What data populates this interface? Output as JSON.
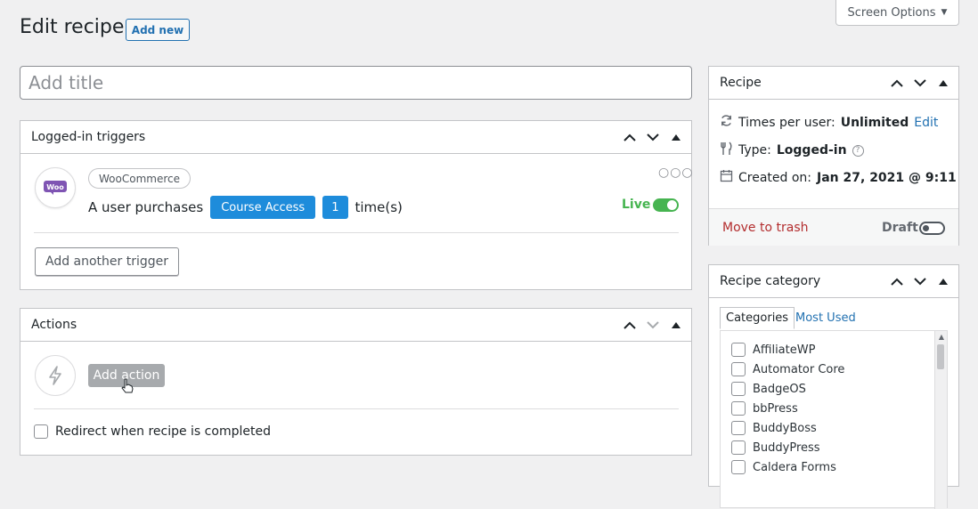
{
  "header": {
    "title": "Edit recipe",
    "add_new": "Add new",
    "screen_options": "Screen Options"
  },
  "title_input": {
    "placeholder": "Add title"
  },
  "triggers": {
    "heading": "Logged-in triggers",
    "integration": "WooCommerce",
    "sentence_prefix": "A user purchases",
    "token_product": "Course Access",
    "token_count": "1",
    "sentence_suffix": "time(s)",
    "status": "Live",
    "add_button": "Add another trigger"
  },
  "actions": {
    "heading": "Actions",
    "add_button": "Add action",
    "redirect_label": "Redirect when recipe is completed"
  },
  "recipe": {
    "heading": "Recipe",
    "times_label": "Times per user:",
    "times_value": "Unlimited",
    "edit_link": "Edit",
    "type_label": "Type:",
    "type_value": "Logged-in",
    "created_label": "Created on:",
    "created_value": "Jan 27, 2021 @ 9:11",
    "trash": "Move to trash",
    "draft": "Draft"
  },
  "category": {
    "heading": "Recipe category",
    "tab_all": "Categories",
    "tab_used": "Most Used",
    "items": [
      "AffiliateWP",
      "Automator Core",
      "BadgeOS",
      "bbPress",
      "BuddyBoss",
      "BuddyPress",
      "Caldera Forms"
    ]
  },
  "colors": {
    "primary": "#2271b1",
    "token": "#1e8cdb",
    "live": "#46b450",
    "trash": "#b32d2e",
    "woo": "#7f54b3"
  }
}
